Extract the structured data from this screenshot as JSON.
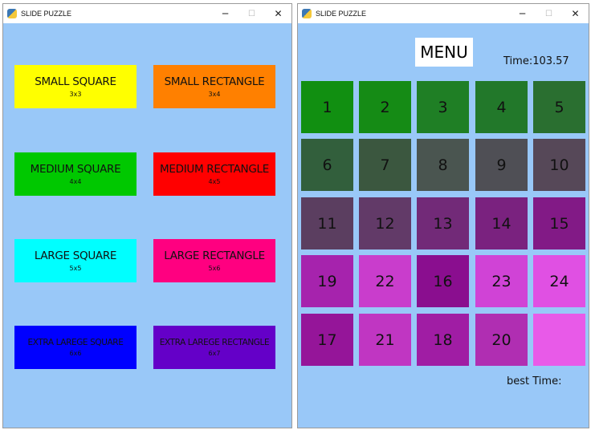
{
  "left_window": {
    "title": "SLIDE PUZZLE",
    "controls": {
      "minimize": "─",
      "maximize": "☐",
      "close": "✕"
    },
    "buttons": [
      {
        "label": "SMALL SQUARE",
        "size": "3x3",
        "color": "#ffff00",
        "small": false
      },
      {
        "label": "SMALL RECTANGLE",
        "size": "3x4",
        "color": "#ff8000",
        "small": false
      },
      {
        "label": "MEDIUM SQUARE",
        "size": "4x4",
        "color": "#00c800",
        "small": false
      },
      {
        "label": "MEDIUM RECTANGLE",
        "size": "4x5",
        "color": "#ff0000",
        "small": false
      },
      {
        "label": "LARGE SQUARE",
        "size": "5x5",
        "color": "#00ffff",
        "small": false
      },
      {
        "label": "LARGE RECTANGLE",
        "size": "5x6",
        "color": "#ff0080",
        "small": false
      },
      {
        "label": "EXTRA LAREGE SQUARE",
        "size": "6x6",
        "color": "#0000ff",
        "small": true
      },
      {
        "label": "EXTRA LAREGE RECTANGLE",
        "size": "6x7",
        "color": "#6400c8",
        "small": true
      }
    ]
  },
  "right_window": {
    "title": "SLIDE PUZZLE",
    "controls": {
      "minimize": "─",
      "maximize": "☐",
      "close": "✕"
    },
    "menu_label": "MENU",
    "timer": "Time:103.57",
    "best_time": "best Time:",
    "tiles": [
      {
        "label": "1",
        "color": "#118f11"
      },
      {
        "label": "2",
        "color": "#158b15"
      },
      {
        "label": "3",
        "color": "#1f7f25"
      },
      {
        "label": "4",
        "color": "#22782a"
      },
      {
        "label": "5",
        "color": "#2a6f30"
      },
      {
        "label": "6",
        "color": "#325f3c"
      },
      {
        "label": "7",
        "color": "#3b573f"
      },
      {
        "label": "8",
        "color": "#4a5550"
      },
      {
        "label": "9",
        "color": "#4f4f55"
      },
      {
        "label": "10",
        "color": "#564858"
      },
      {
        "label": "11",
        "color": "#5b3e60"
      },
      {
        "label": "12",
        "color": "#623a68"
      },
      {
        "label": "13",
        "color": "#722a78"
      },
      {
        "label": "14",
        "color": "#7a227f"
      },
      {
        "label": "15",
        "color": "#821a86"
      },
      {
        "label": "19",
        "color": "#a623ad"
      },
      {
        "label": "22",
        "color": "#c93dcc"
      },
      {
        "label": "16",
        "color": "#8a0e8f"
      },
      {
        "label": "23",
        "color": "#d043d6"
      },
      {
        "label": "24",
        "color": "#e050e3"
      },
      {
        "label": "17",
        "color": "#951599"
      },
      {
        "label": "21",
        "color": "#c036c2"
      },
      {
        "label": "18",
        "color": "#a01da4"
      },
      {
        "label": "20",
        "color": "#b02eb2"
      },
      {
        "label": "",
        "color": "#e85ae8"
      }
    ]
  }
}
